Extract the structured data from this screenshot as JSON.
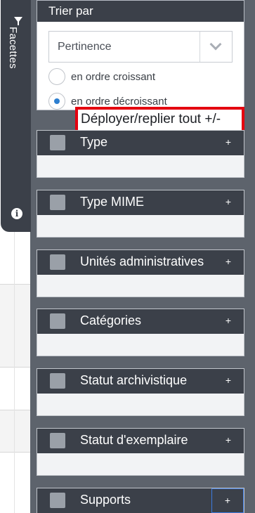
{
  "side_tab": {
    "label": "Facettes",
    "icons": [
      "funnel-icon",
      "info-icon"
    ]
  },
  "sort": {
    "header": "Trier par",
    "select_value": "Pertinence",
    "options": [
      {
        "label": "en ordre croissant",
        "checked": false
      },
      {
        "label": "en ordre décroissant",
        "checked": true
      }
    ]
  },
  "toggle_all": {
    "label": "Déployer/replier tout +/-",
    "highlight_color": "#e4000f"
  },
  "facets": [
    {
      "title": "Type",
      "toggle": "+"
    },
    {
      "title": "Type MIME",
      "toggle": "+"
    },
    {
      "title": "Unités administratives",
      "toggle": "+"
    },
    {
      "title": "Catégories",
      "toggle": "+"
    },
    {
      "title": "Statut archivistique",
      "toggle": "+"
    },
    {
      "title": "Statut d'exemplaire",
      "toggle": "+"
    },
    {
      "title": "Supports",
      "toggle": "+"
    }
  ],
  "colors": {
    "panel": "#5d636c",
    "header": "#3b4049",
    "accent": "#2d7fd0"
  }
}
